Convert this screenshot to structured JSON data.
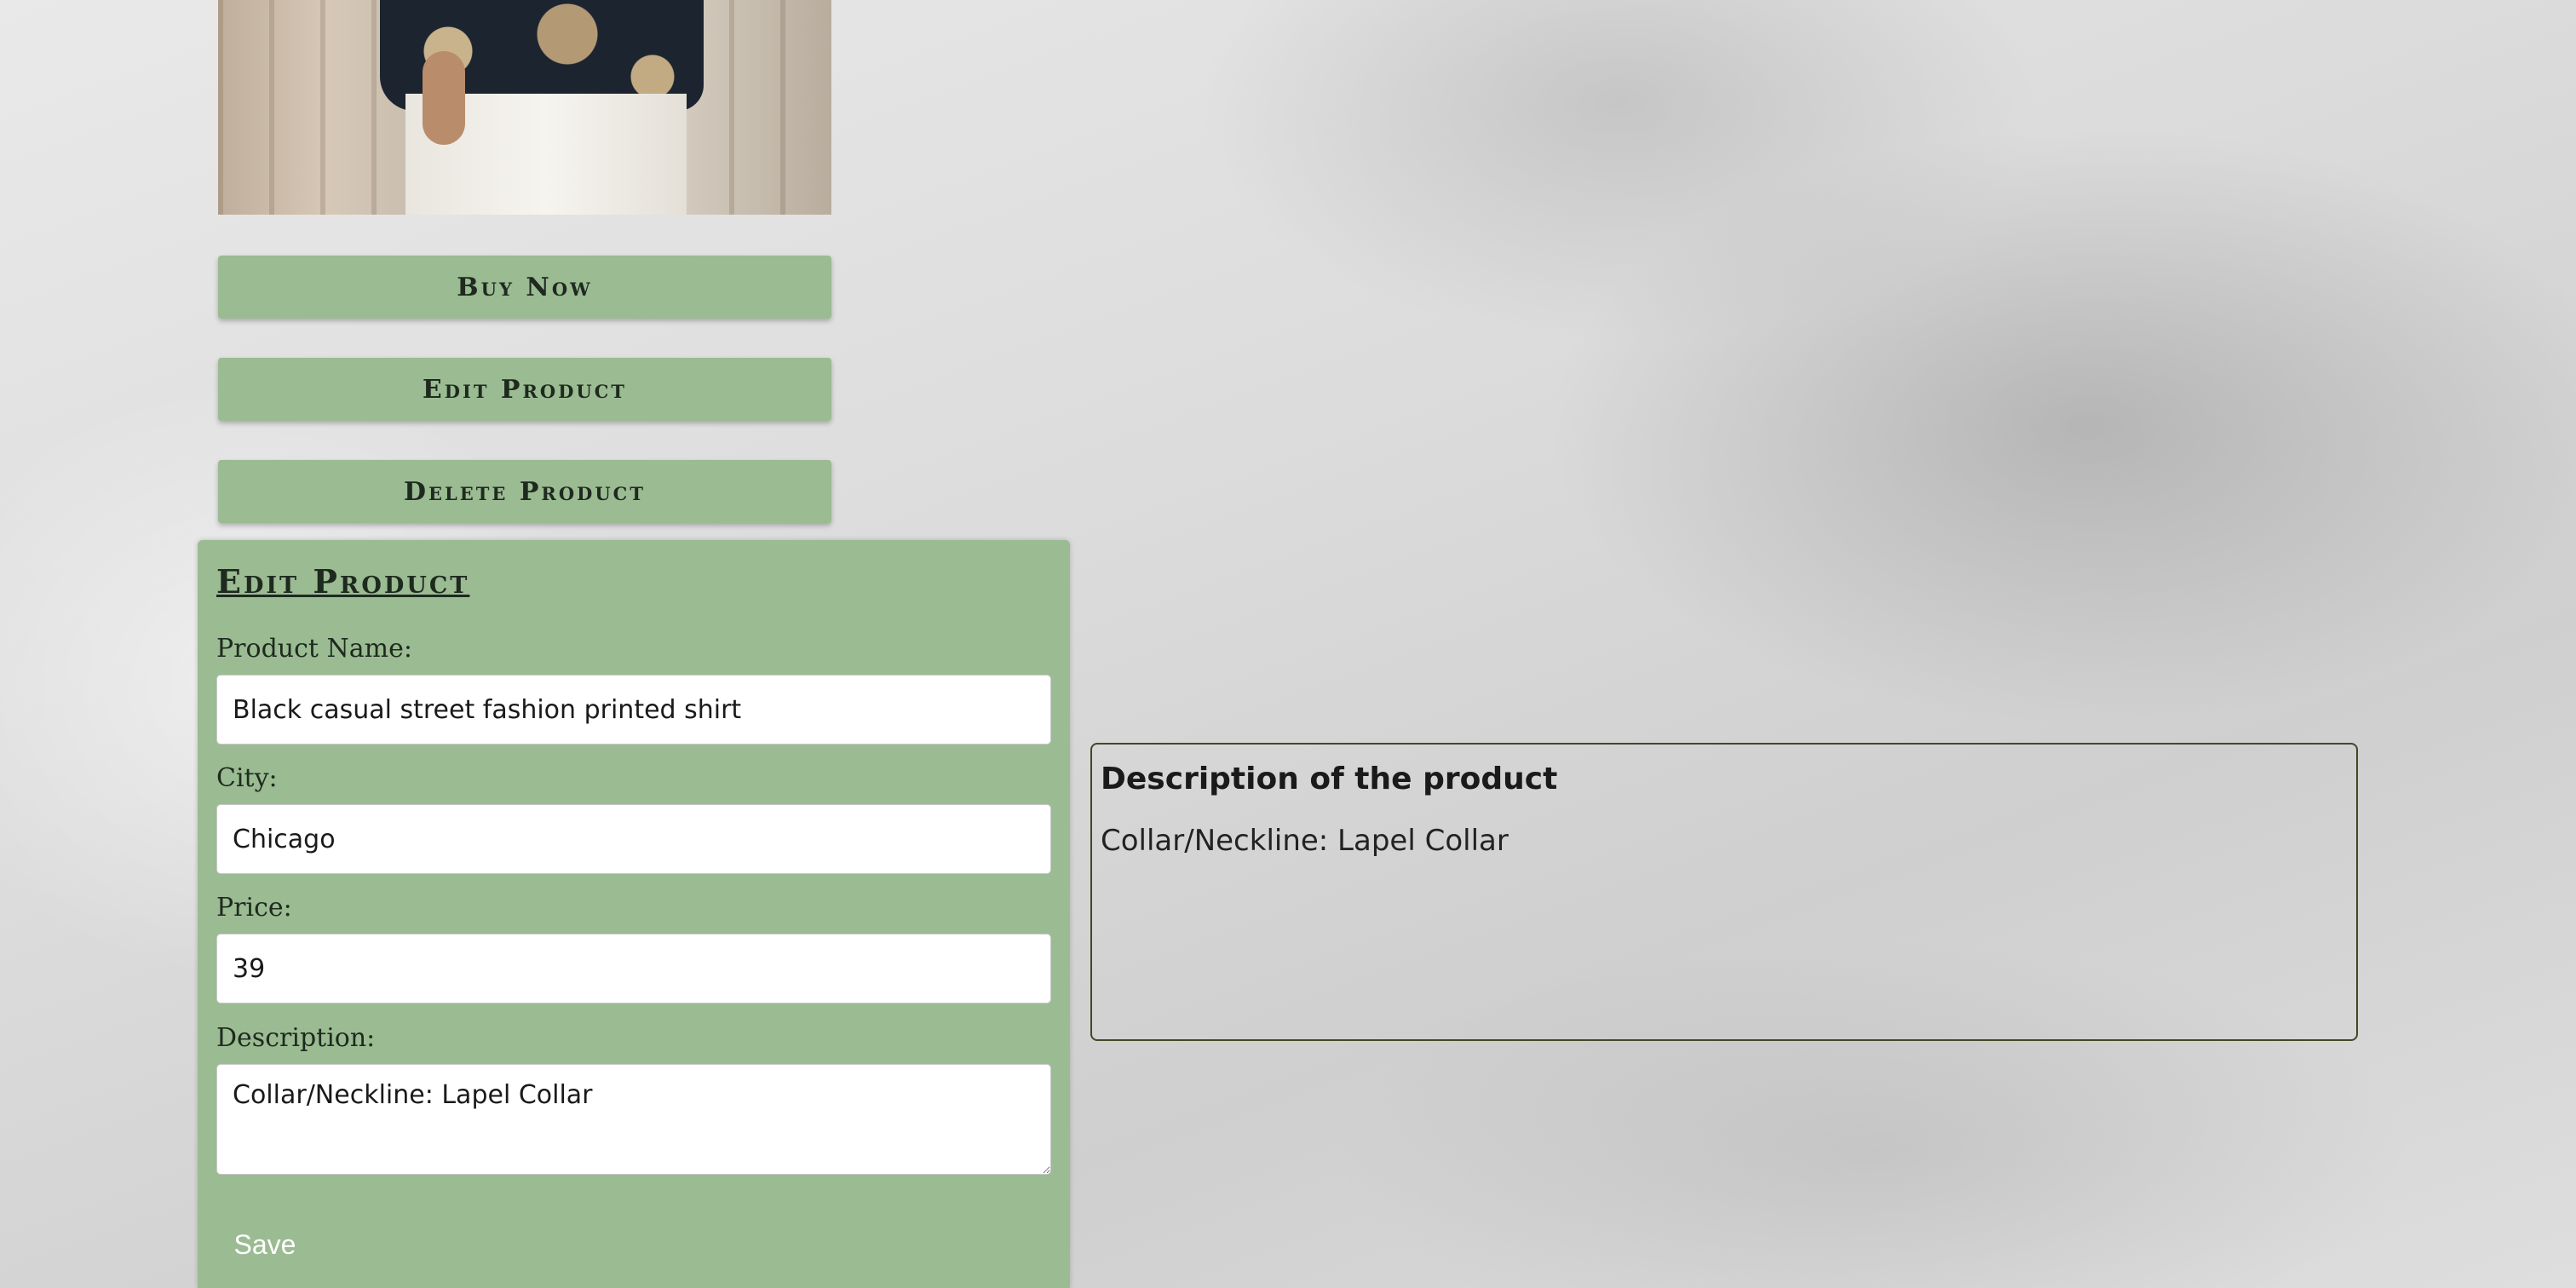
{
  "product": {
    "image_alt": "Black casual street fashion printed shirt"
  },
  "actions": {
    "buy_label": "Buy Now",
    "edit_label": "Edit Product",
    "delete_label": "Delete Product"
  },
  "edit_form": {
    "title": "Edit Product",
    "name_label": "Product Name:",
    "name_value": "Black casual street fashion printed shirt",
    "city_label": "City:",
    "city_value": "Chicago",
    "price_label": "Price:",
    "price_value": "39",
    "description_label": "Description:",
    "description_value": "Collar/Neckline: Lapel Collar",
    "save_label": "Save"
  },
  "description_panel": {
    "heading": "Description of the product",
    "text": "Collar/Neckline: Lapel Collar"
  },
  "colors": {
    "accent_green": "#9bbb93",
    "desc_border": "#3f4a24"
  }
}
